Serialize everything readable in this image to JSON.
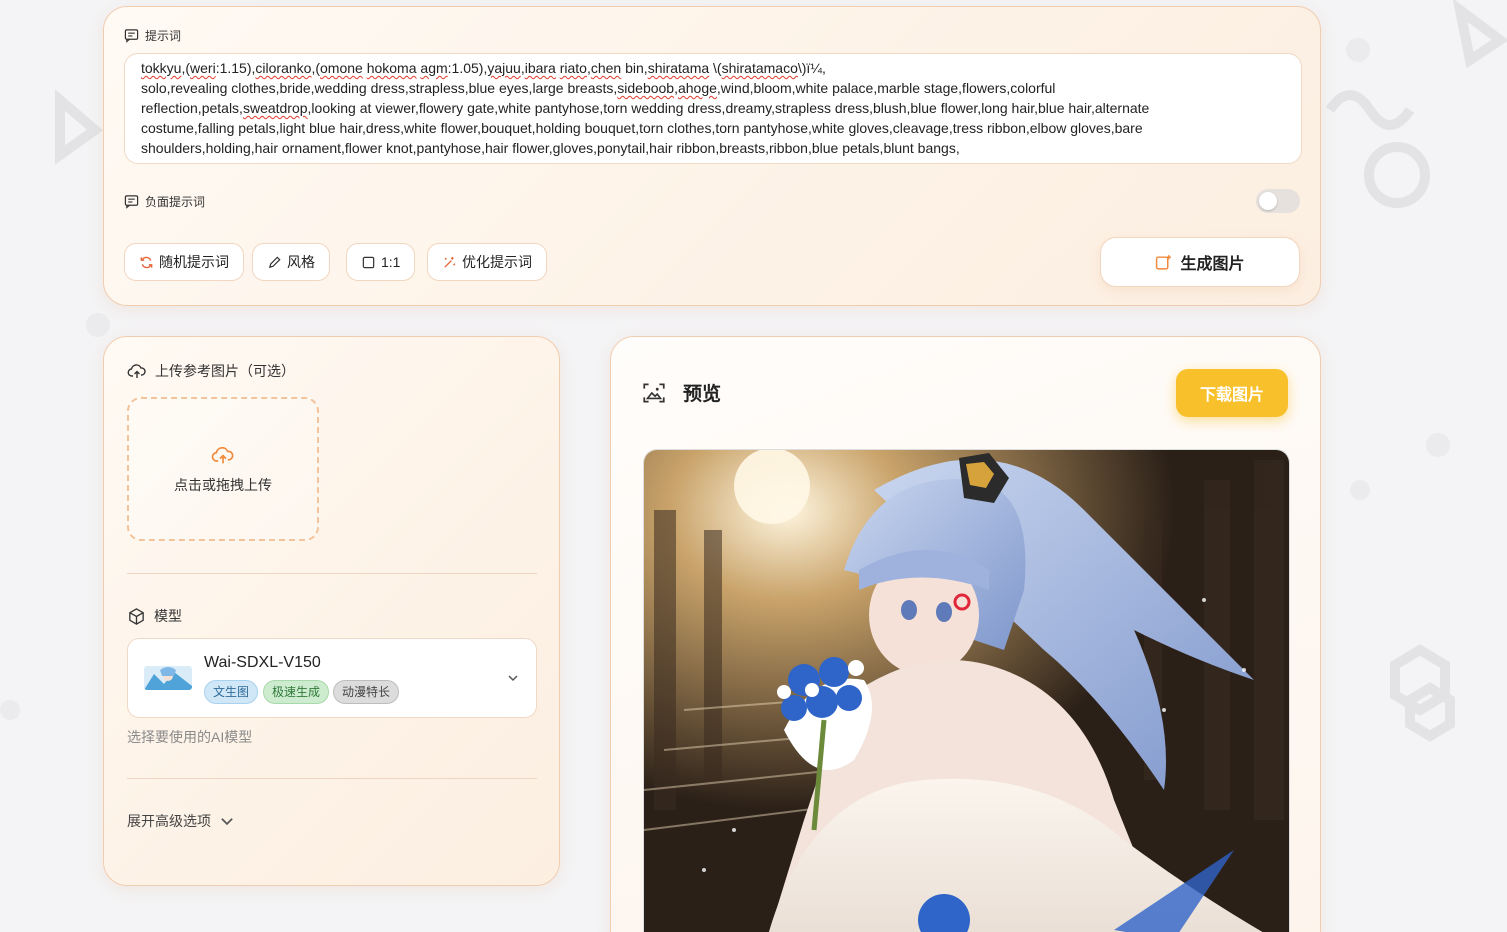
{
  "prompt": {
    "label": "提示词",
    "text_parts": [
      {
        "t": "tokkyu",
        "err": true
      },
      {
        "t": ",(",
        "err": false
      },
      {
        "t": "weri",
        "err": true
      },
      {
        "t": ":1.15),",
        "err": false
      },
      {
        "t": "ciloranko",
        "err": true
      },
      {
        "t": ",(",
        "err": false
      },
      {
        "t": "omone",
        "err": true
      },
      {
        "t": " ",
        "err": false
      },
      {
        "t": "hokoma",
        "err": true
      },
      {
        "t": " ",
        "err": false
      },
      {
        "t": "agm",
        "err": true
      },
      {
        "t": ":1.05),",
        "err": false
      },
      {
        "t": "yajuu",
        "err": true
      },
      {
        "t": ",",
        "err": false
      },
      {
        "t": "ibara",
        "err": true
      },
      {
        "t": " ",
        "err": false
      },
      {
        "t": "riato",
        "err": true
      },
      {
        "t": ",",
        "err": false
      },
      {
        "t": "chen",
        "err": true
      },
      {
        "t": " bin,",
        "err": false
      },
      {
        "t": "shiratama",
        "err": true
      },
      {
        "t": " \\(",
        "err": false
      },
      {
        "t": "shiratamaco",
        "err": true
      },
      {
        "t": "\\)ï¼",
        "err": false
      },
      {
        "t": ",\nsolo,revealing clothes,bride,wedding dress,strapless,blue eyes,large breasts,",
        "err": false
      },
      {
        "t": "sideboob",
        "err": true
      },
      {
        "t": ",",
        "err": false
      },
      {
        "t": "ahoge",
        "err": true
      },
      {
        "t": ",wind,bloom,white palace,marble stage,flowers,colorful\nreflection,petals,",
        "err": false
      },
      {
        "t": "sweatdrop",
        "err": true
      },
      {
        "t": ",looking at viewer,flowery gate,white pantyhose,torn wedding dress,dreamy,strapless dress,blush,blue flower,long hair,blue hair,alternate\ncostume,falling petals,light blue hair,dress,white flower,bouquet,holding bouquet,torn clothes,torn pantyhose,white gloves,cleavage,tress ribbon,elbow gloves,bare\nshoulders,holding,hair ornament,flower knot,pantyhose,hair flower,gloves,ponytail,hair ribbon,breasts,ribbon,blue petals,blunt bangs,",
        "err": false
      }
    ]
  },
  "negative_prompt": {
    "label": "负面提示词",
    "enabled": false
  },
  "toolbar": {
    "random_label": "随机提示词",
    "style_label": "风格",
    "ratio_label": "1:1",
    "optimize_label": "优化提示词",
    "generate_label": "生成图片"
  },
  "upload": {
    "label": "上传参考图片（可选）",
    "drop_text": "点击或拖拽上传"
  },
  "model": {
    "label": "模型",
    "name": "Wai-SDXL-V150",
    "tags": [
      "文生图",
      "极速生成",
      "动漫特长"
    ],
    "hint": "选择要使用的AI模型"
  },
  "advanced": {
    "label": "展开高级选项"
  },
  "preview": {
    "title": "预览",
    "download_label": "下载图片"
  },
  "colors": {
    "accent": "#f8c02a",
    "icon_orange": "#f08a3c",
    "border": "#f1cdb0"
  }
}
